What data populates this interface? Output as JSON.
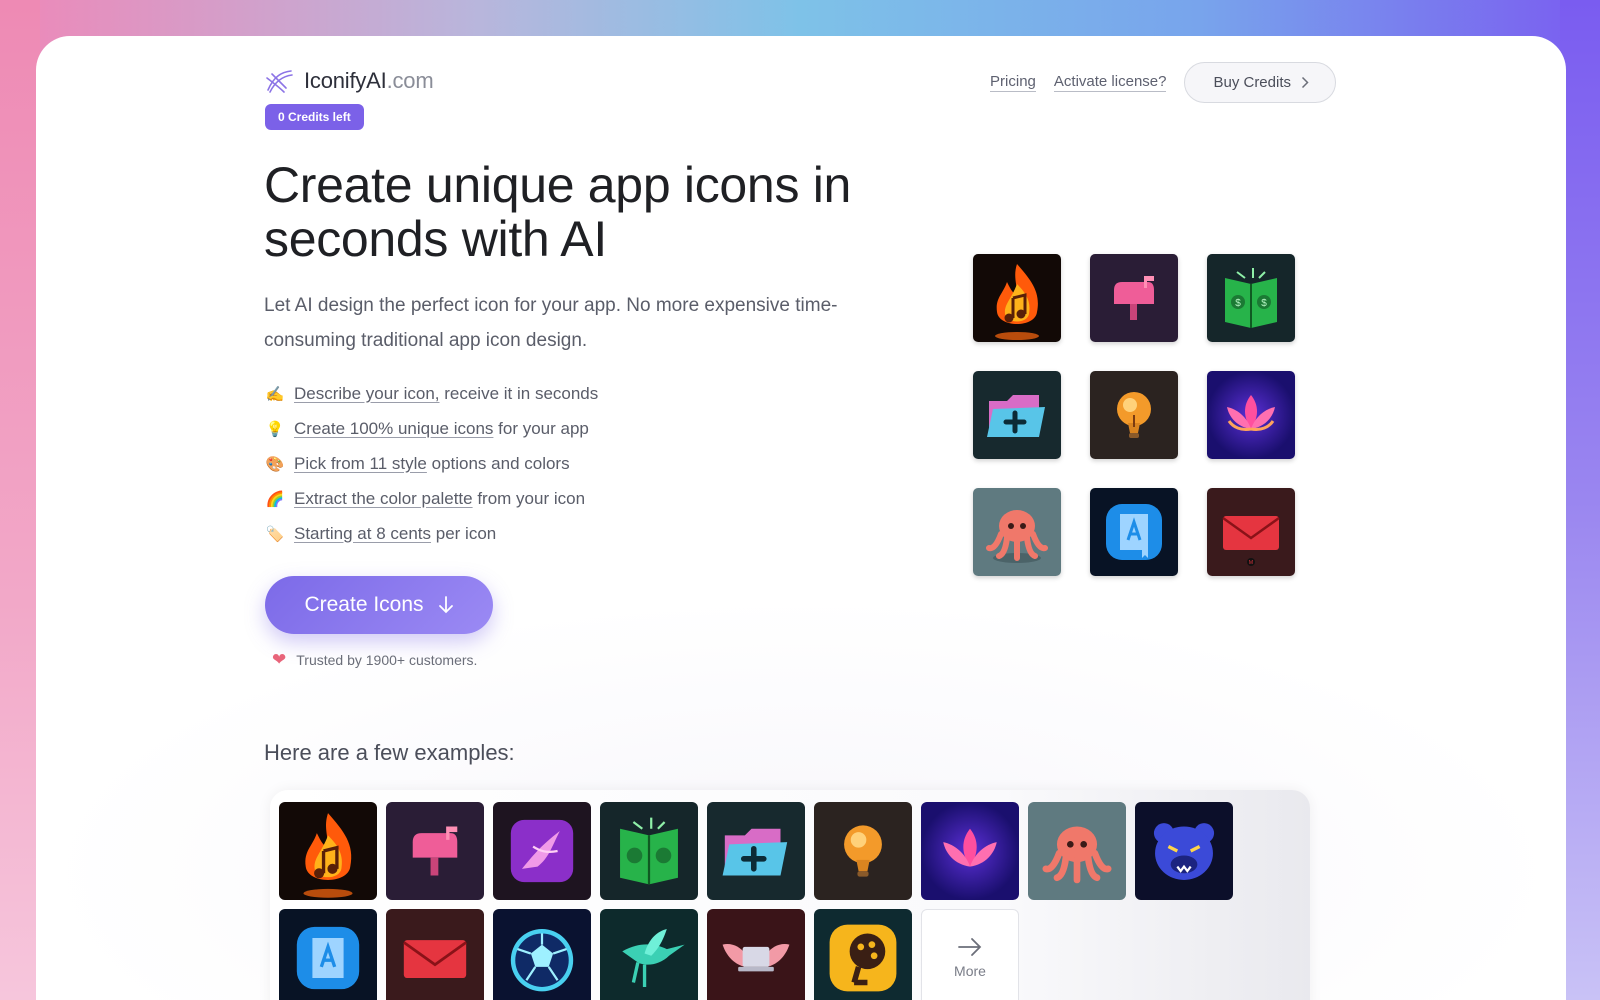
{
  "header": {
    "brand_name": "IconifyAI",
    "brand_domain": ".com",
    "credits_badge": "0 Credits left",
    "nav": {
      "pricing": "Pricing",
      "activate": "Activate license?",
      "buy": "Buy Credits"
    }
  },
  "hero": {
    "title": "Create unique app icons in seconds with AI",
    "subtitle": "Let AI design the perfect icon for your app. No more expensive time-consuming traditional app icon design.",
    "features": [
      {
        "emoji": "✍️",
        "link": "Describe your icon,",
        "rest": " receive it in seconds"
      },
      {
        "emoji": "💡",
        "link": "Create 100% unique icons",
        "rest": " for your app"
      },
      {
        "emoji": "🎨",
        "link": "Pick from 11 style",
        "rest": " options and colors"
      },
      {
        "emoji": "🌈",
        "link": "Extract the color palette",
        "rest": " from your icon"
      },
      {
        "emoji": "🏷️",
        "link": "Starting at 8 cents",
        "rest": " per icon"
      }
    ],
    "cta_label": "Create Icons",
    "trusted": "Trusted by 1900+ customers."
  },
  "examples": {
    "title": "Here are a few examples:",
    "more_label": "More"
  },
  "colors": {
    "accent": "#7b61e8",
    "heart": "#e8647a"
  }
}
